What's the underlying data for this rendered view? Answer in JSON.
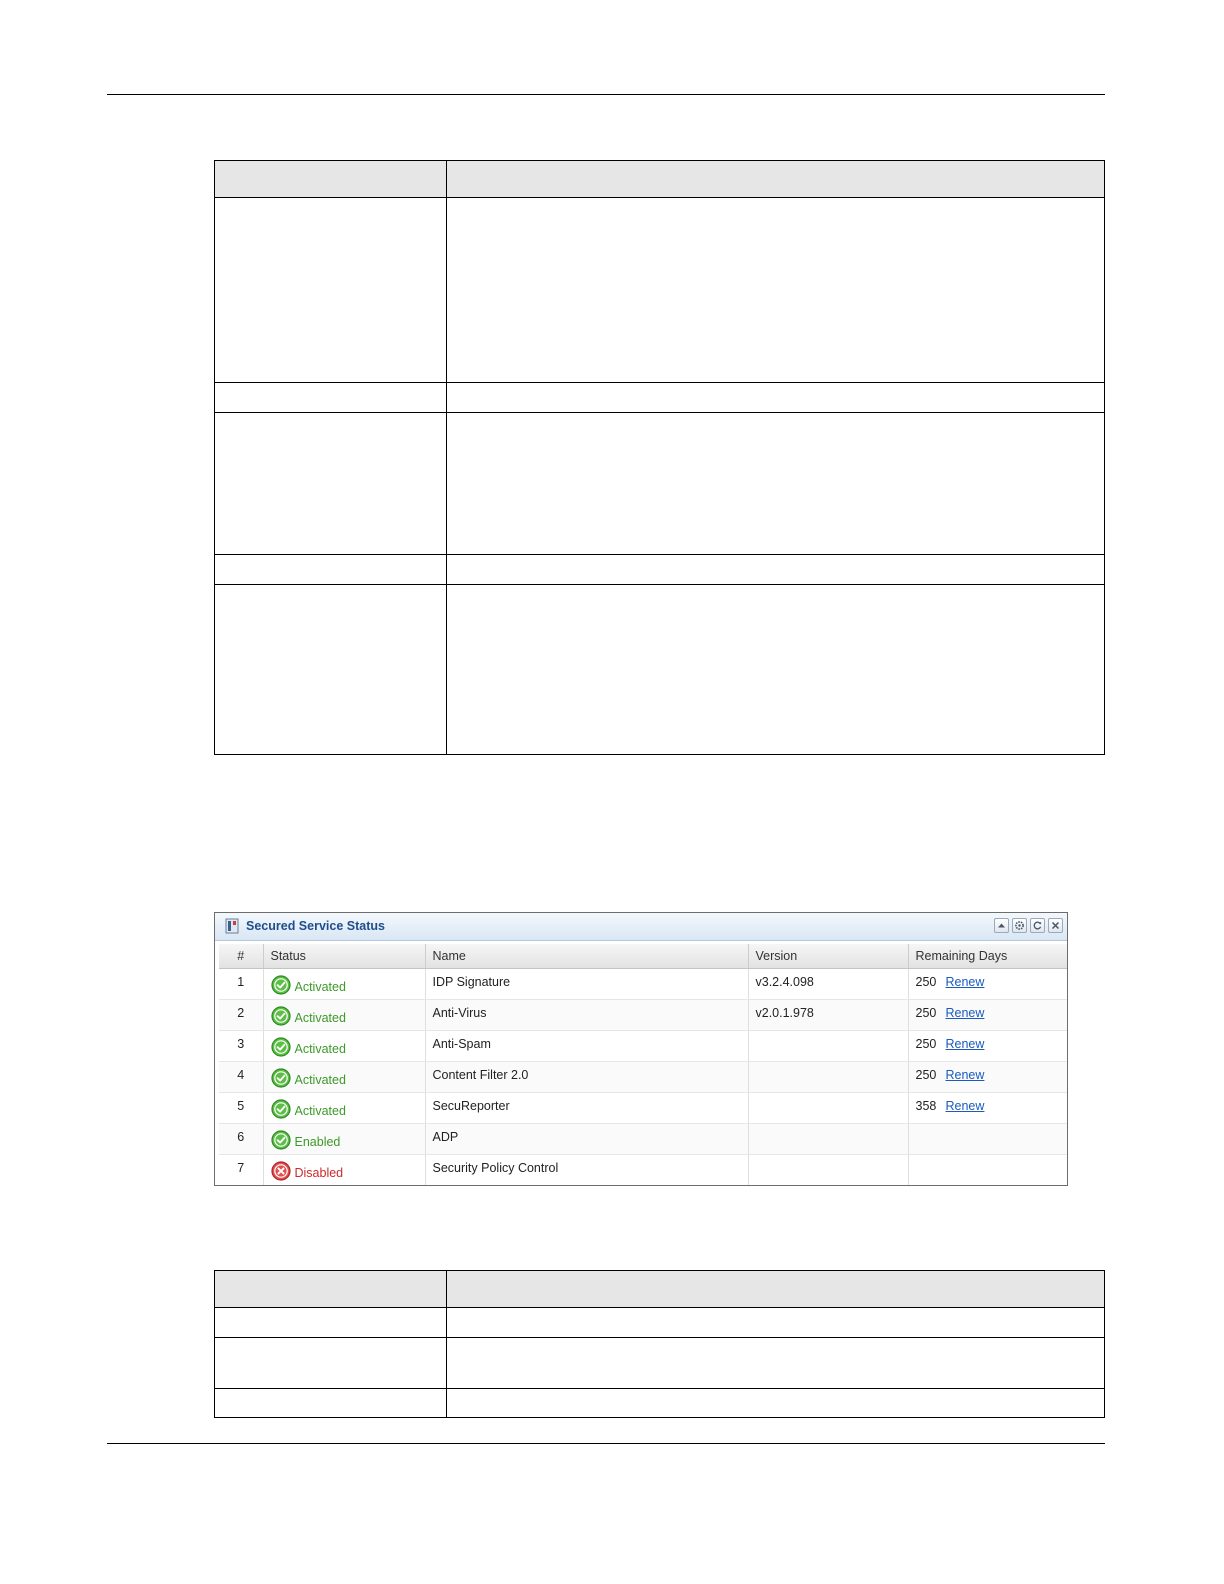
{
  "widget": {
    "title": "Secured Service Status",
    "controls": [
      "collapse-icon",
      "settings-icon",
      "refresh-icon",
      "close-icon"
    ],
    "columns": [
      "#",
      "Status",
      "Name",
      "Version",
      "Remaining Days"
    ],
    "rows": [
      {
        "num": "1",
        "status": "Activated",
        "state": "ok",
        "name": "IDP Signature",
        "version": "v3.2.4.098",
        "days": "250",
        "action": "Renew"
      },
      {
        "num": "2",
        "status": "Activated",
        "state": "ok",
        "name": "Anti-Virus",
        "version": "v2.0.1.978",
        "days": "250",
        "action": "Renew"
      },
      {
        "num": "3",
        "status": "Activated",
        "state": "ok",
        "name": "Anti-Spam",
        "version": "",
        "days": "250",
        "action": "Renew"
      },
      {
        "num": "4",
        "status": "Activated",
        "state": "ok",
        "name": "Content Filter 2.0",
        "version": "",
        "days": "250",
        "action": "Renew"
      },
      {
        "num": "5",
        "status": "Activated",
        "state": "ok",
        "name": "SecuReporter",
        "version": "",
        "days": "358",
        "action": "Renew"
      },
      {
        "num": "6",
        "status": "Enabled",
        "state": "ok",
        "name": "ADP",
        "version": "",
        "days": "",
        "action": ""
      },
      {
        "num": "7",
        "status": "Disabled",
        "state": "bad",
        "name": "Security Policy Control",
        "version": "",
        "days": "",
        "action": ""
      }
    ]
  },
  "colors": {
    "ok": "#3c9a28",
    "bad": "#cc2a2a",
    "link": "#1a5bbd",
    "title": "#1f4e8c"
  }
}
